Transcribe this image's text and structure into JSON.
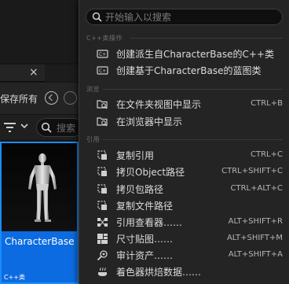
{
  "background": {
    "tab_close_glyph": "×",
    "toolbar_save_label": "保存所有",
    "search_placeholder": "搜索",
    "asset": {
      "name": "CharacterBase",
      "type": "C++类"
    }
  },
  "menu": {
    "search_placeholder": "开始输入以搜索",
    "sections": {
      "cpp": "C++类操作",
      "browse": "浏览",
      "references": "引用"
    },
    "items": {
      "create_derived": {
        "label": "创建派生自CharacterBase的C++类",
        "shortcut": ""
      },
      "create_blueprint": {
        "label": "创建基于CharacterBase的蓝图类",
        "shortcut": ""
      },
      "show_in_explorer": {
        "label": "在文件夹视图中显示",
        "shortcut": "CTRL+B"
      },
      "show_in_browser": {
        "label": "在浏览器中显示",
        "shortcut": ""
      },
      "copy_reference": {
        "label": "复制引用",
        "shortcut": "CTRL+C"
      },
      "copy_object_path": {
        "label": "拷贝Object路径",
        "shortcut": "CTRL+SHIFT+C"
      },
      "copy_package_path": {
        "label": "拷贝包路径",
        "shortcut": "CTRL+ALT+C"
      },
      "copy_file_path": {
        "label": "复制文件路径",
        "shortcut": ""
      },
      "reference_viewer": {
        "label": "引用查看器……",
        "shortcut": "ALT+SHIFT+R"
      },
      "size_map": {
        "label": "尺寸贴图……",
        "shortcut": "ALT+SHIFT+M"
      },
      "audit_assets": {
        "label": "审计资产……",
        "shortcut": "ALT+SHIFT+A"
      },
      "shader_cook": {
        "label": "着色器烘焙数据……",
        "shortcut": ""
      }
    }
  },
  "colors": {
    "menu_bg": "#242424",
    "selection_blue": "#0c6be0",
    "text": "#dcdcdc",
    "muted": "#6f6f6f"
  }
}
